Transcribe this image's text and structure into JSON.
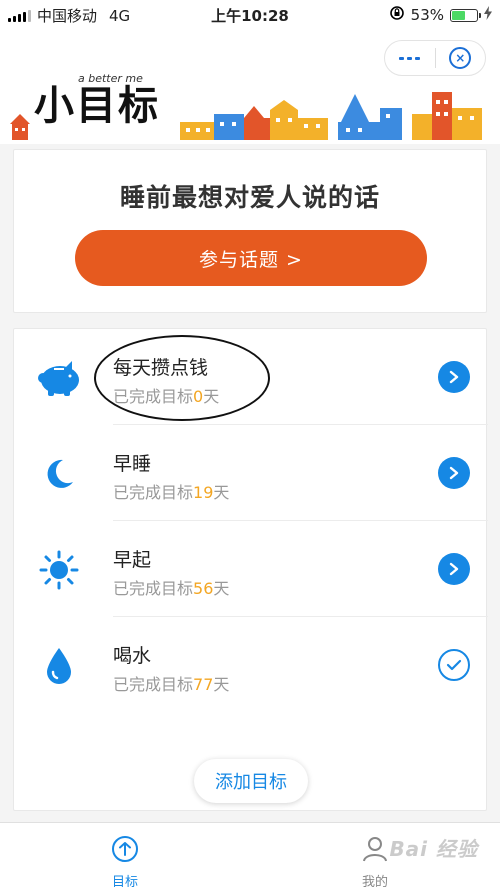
{
  "status_bar": {
    "carrier": "中国移动",
    "network": "4G",
    "time": "上午10:28",
    "battery_percent": "53%",
    "battery_level": 0.53
  },
  "header": {
    "logo_text": "小目标",
    "logo_tagline": "a better me",
    "more_icon": "more-dots-icon",
    "close_icon": "close-target-icon"
  },
  "topic": {
    "title": "睡前最想对爱人说的话",
    "button_label": "参与话题 >",
    "button_color": "#e65a1f"
  },
  "goals": {
    "prefix": "已完成目标",
    "suffix": "天",
    "items": [
      {
        "name": "每天攒点钱",
        "days": "0",
        "icon": "piggy-bank-icon",
        "action": "arrow-right-icon"
      },
      {
        "name": "早睡",
        "days": "19",
        "icon": "moon-icon",
        "action": "arrow-right-icon"
      },
      {
        "name": "早起",
        "days": "56",
        "icon": "sun-icon",
        "action": "arrow-right-icon"
      },
      {
        "name": "喝水",
        "days": "77",
        "icon": "water-drop-icon",
        "action": "check-icon"
      }
    ],
    "add_label": "添加目标"
  },
  "tabbar": {
    "goal_label": "目标",
    "mine_label": "我的",
    "watermark": "Bai 经验"
  },
  "colors": {
    "accent": "#1688e4",
    "highlight_number": "#f3a623",
    "topic_button": "#e65a1f"
  }
}
